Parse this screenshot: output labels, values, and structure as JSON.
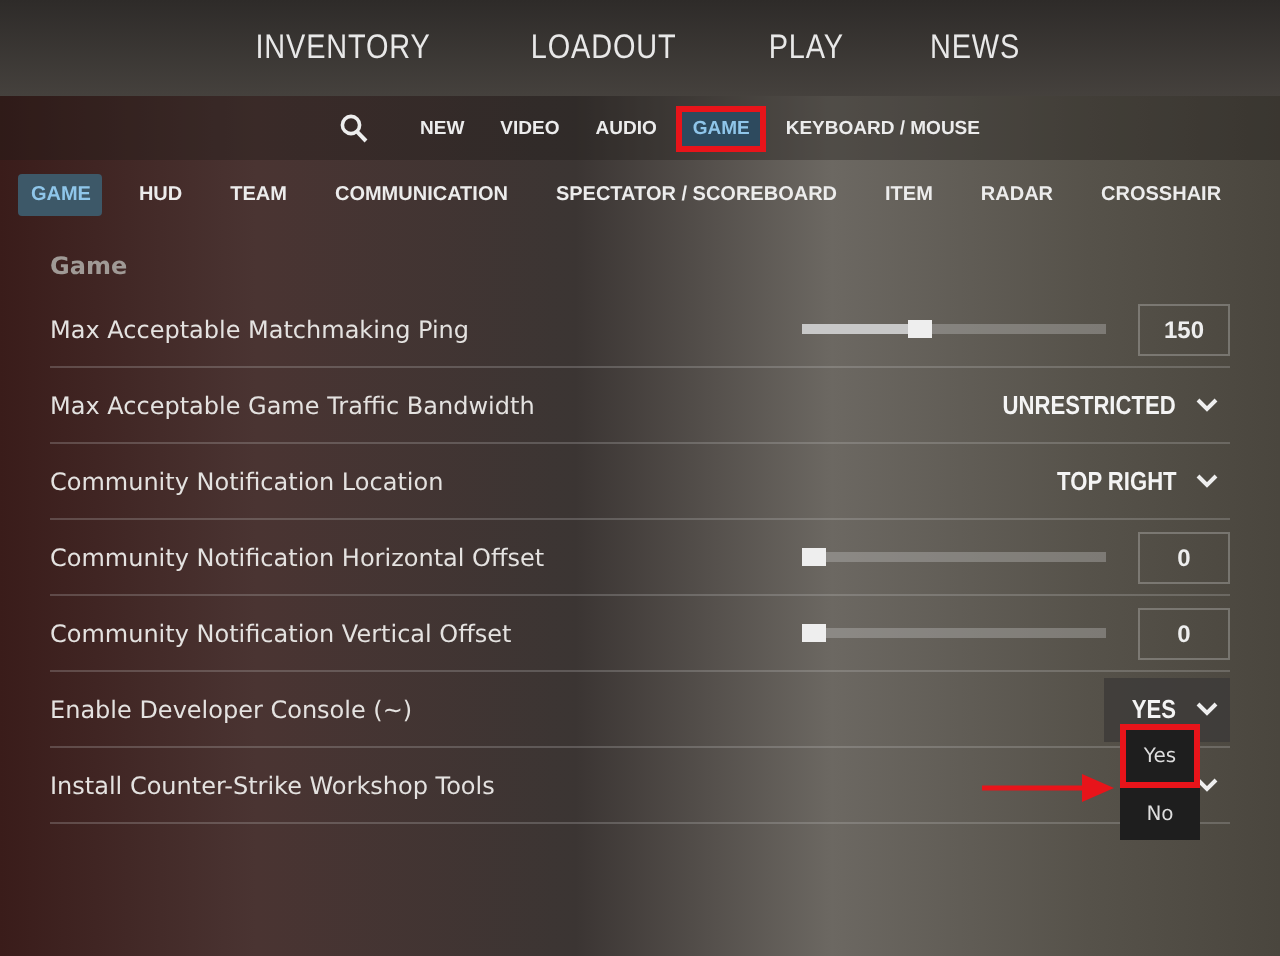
{
  "main_nav": [
    {
      "label": "INVENTORY"
    },
    {
      "label": "LOADOUT"
    },
    {
      "label": "PLAY"
    },
    {
      "label": "NEWS"
    }
  ],
  "settings_tabs": [
    {
      "label": "NEW",
      "selected": false,
      "highlighted": false
    },
    {
      "label": "VIDEO",
      "selected": false,
      "highlighted": false
    },
    {
      "label": "AUDIO",
      "selected": false,
      "highlighted": false
    },
    {
      "label": "GAME",
      "selected": true,
      "highlighted": true
    },
    {
      "label": "KEYBOARD / MOUSE",
      "selected": false,
      "highlighted": false
    }
  ],
  "sub_tabs": [
    {
      "label": "GAME",
      "selected": true
    },
    {
      "label": "HUD",
      "selected": false
    },
    {
      "label": "TEAM",
      "selected": false
    },
    {
      "label": "COMMUNICATION",
      "selected": false
    },
    {
      "label": "SPECTATOR / SCOREBOARD",
      "selected": false
    },
    {
      "label": "ITEM",
      "selected": false
    },
    {
      "label": "RADAR",
      "selected": false
    },
    {
      "label": "CROSSHAIR",
      "selected": false
    }
  ],
  "section_title": "Game",
  "settings": [
    {
      "kind": "slider",
      "label": "Max Acceptable Matchmaking Ping",
      "level": 0.39,
      "value": "150"
    },
    {
      "kind": "dropdown",
      "label": "Max Acceptable Game Traffic Bandwidth",
      "value": "UNRESTRICTED",
      "focused": false,
      "open": false
    },
    {
      "kind": "dropdown",
      "label": "Community Notification Location",
      "value": "TOP RIGHT",
      "focused": false,
      "open": false
    },
    {
      "kind": "slider",
      "label": "Community Notification Horizontal Offset",
      "level": 0.03,
      "value": "0"
    },
    {
      "kind": "slider",
      "label": "Community Notification Vertical Offset",
      "level": 0.03,
      "value": "0"
    },
    {
      "kind": "dropdown",
      "label": "Enable Developer Console (~)",
      "value": "YES",
      "focused": true,
      "open": false
    },
    {
      "kind": "dropdown",
      "label": "Install Counter-Strike Workshop Tools",
      "focused": false,
      "open": true,
      "options": [
        {
          "label": "Yes",
          "highlighted": true
        },
        {
          "label": "No",
          "highlighted": false
        }
      ]
    }
  ]
}
